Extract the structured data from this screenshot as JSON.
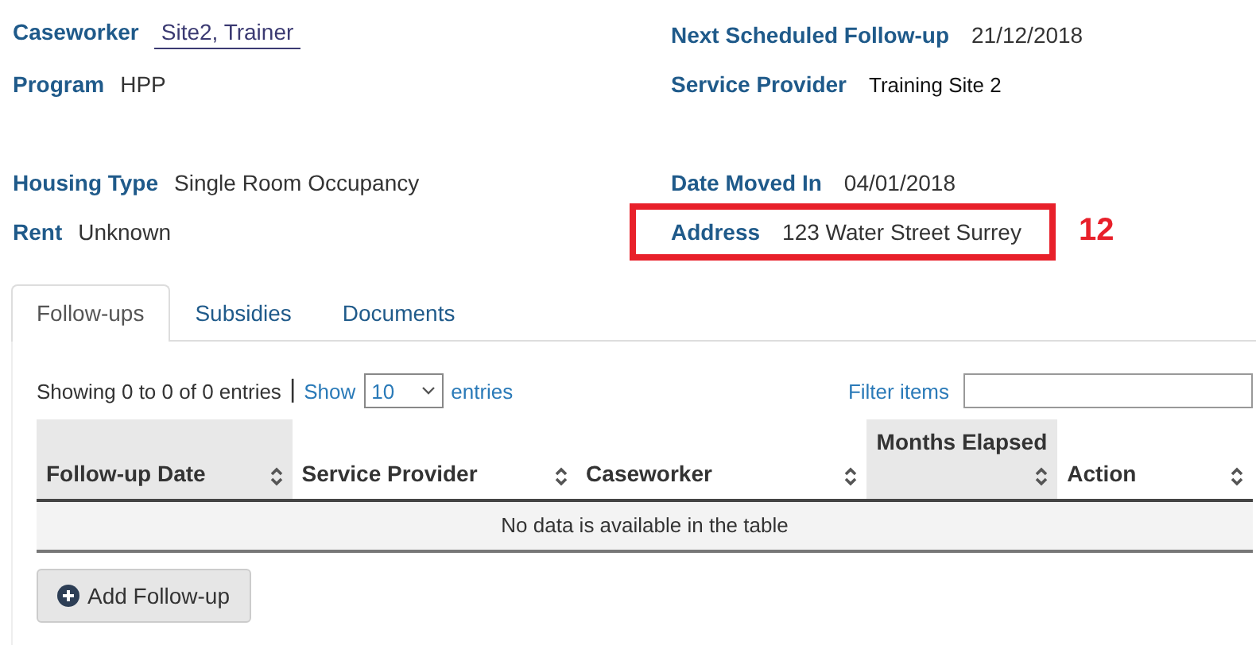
{
  "details": [
    {
      "rows": [
        {
          "left": {
            "label": "Caseworker",
            "value": "Site2, Trainer",
            "kind": "link"
          },
          "right": {
            "label": "Next Scheduled Follow-up",
            "value": "21/12/2018",
            "kind": "text",
            "highlighted": false
          }
        },
        {
          "left": {
            "label": "Program",
            "value": "HPP",
            "kind": "text"
          },
          "right": {
            "label": "Service Provider",
            "value": "Training Site 2",
            "kind": "dark",
            "highlighted": false
          }
        }
      ]
    },
    {
      "rows": [
        {
          "left": {
            "label": "Housing Type",
            "value": "Single Room Occupancy",
            "kind": "text"
          },
          "right": {
            "label": "Date Moved In",
            "value": "04/01/2018",
            "kind": "text",
            "highlighted": false
          }
        },
        {
          "left": {
            "label": "Rent",
            "value": "Unknown",
            "kind": "text"
          },
          "right": {
            "label": "Address",
            "value": "123 Water Street Surrey",
            "kind": "text",
            "highlighted": true
          }
        }
      ]
    }
  ],
  "annotation": "12",
  "tabs": [
    {
      "label": "Follow-ups",
      "selected": true
    },
    {
      "label": "Subsidies",
      "selected": false
    },
    {
      "label": "Documents",
      "selected": false
    }
  ],
  "table_info": {
    "showing": "Showing 0 to 0 of 0 entries",
    "separator": "|",
    "show_label": "Show",
    "page_size": "10",
    "entries_label": "entries",
    "filter_label": "Filter items"
  },
  "table": {
    "columns": [
      {
        "label": "Follow-up Date",
        "sorted": true
      },
      {
        "label": "Service Provider",
        "sorted": false
      },
      {
        "label": "Caseworker",
        "sorted": false
      },
      {
        "label": "Months Elapsed",
        "sorted": true
      },
      {
        "label": "Action",
        "sorted": false
      }
    ],
    "empty_message": "No data is available in the table"
  },
  "add_button": "Add Follow-up"
}
